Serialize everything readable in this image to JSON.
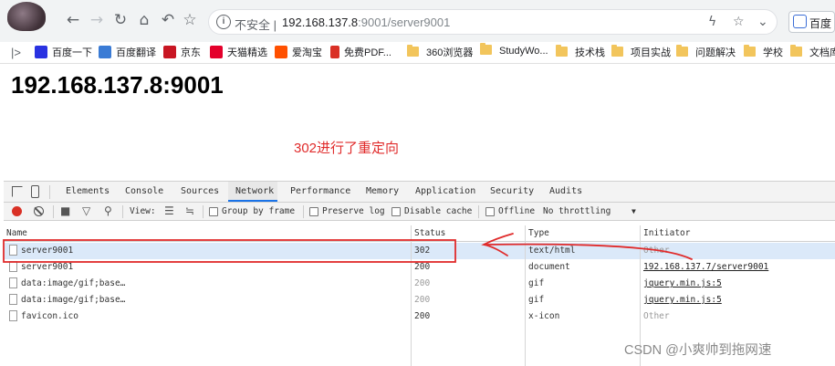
{
  "browser": {
    "omnibox": {
      "security_label": "不安全",
      "separator": "|",
      "url_host": "192.168.137.8",
      "url_rest": ":9001/server9001"
    },
    "ext_label": "百度"
  },
  "bookmarks": [
    {
      "label": "百度一下",
      "color": "#2932e1"
    },
    {
      "label": "百度翻译",
      "color": "#3a7bd5"
    },
    {
      "label": "京东",
      "color": "#c81623"
    },
    {
      "label": "天猫精选",
      "color": "#e4002b"
    },
    {
      "label": "爱淘宝",
      "color": "#ff5000"
    },
    {
      "label": "免费PDF...",
      "color": "#d93025"
    },
    {
      "label": "360浏览器",
      "color": "#f2c55c"
    },
    {
      "label": "StudyWo...",
      "color": "#f2c55c"
    },
    {
      "label": "技术栈",
      "color": "#f2c55c"
    },
    {
      "label": "项目实战",
      "color": "#f2c55c"
    },
    {
      "label": "问题解决",
      "color": "#f2c55c"
    },
    {
      "label": "学校",
      "color": "#f2c55c"
    },
    {
      "label": "文档库",
      "color": "#f2c55c"
    }
  ],
  "page": {
    "heading": "192.168.137.8:9001",
    "annotation": "302进行了重定向"
  },
  "devtools": {
    "tabs": [
      "Elements",
      "Console",
      "Sources",
      "Network",
      "Performance",
      "Memory",
      "Application",
      "Security",
      "Audits"
    ],
    "active_tab": "Network",
    "toolbar": {
      "view_label": "View:",
      "group_by_frame": "Group by frame",
      "preserve_log": "Preserve log",
      "disable_cache": "Disable cache",
      "offline": "Offline",
      "throttling": "No throttling"
    },
    "columns": [
      "Name",
      "Status",
      "Type",
      "Initiator"
    ],
    "rows": [
      {
        "name": "server9001",
        "status": "302",
        "type": "text/html",
        "initiator": "Other",
        "selected": true
      },
      {
        "name": "server9001",
        "status": "200",
        "type": "document",
        "initiator": "192.168.137.7/server9001",
        "selected": false
      },
      {
        "name": "data:image/gif;base…",
        "status": "200",
        "type": "gif",
        "initiator": "jquery.min.js:5",
        "selected": false
      },
      {
        "name": "data:image/gif;base…",
        "status": "200",
        "type": "gif",
        "initiator": "jquery.min.js:5",
        "selected": false
      },
      {
        "name": "favicon.ico",
        "status": "200",
        "type": "x-icon",
        "initiator": "Other",
        "selected": false
      }
    ]
  },
  "watermark": "CSDN @小爽帅到拖网速",
  "colors": {
    "annotation_red": "#e02b2b",
    "selected_row": "#dbe9f9",
    "record_red": "#d93025"
  }
}
